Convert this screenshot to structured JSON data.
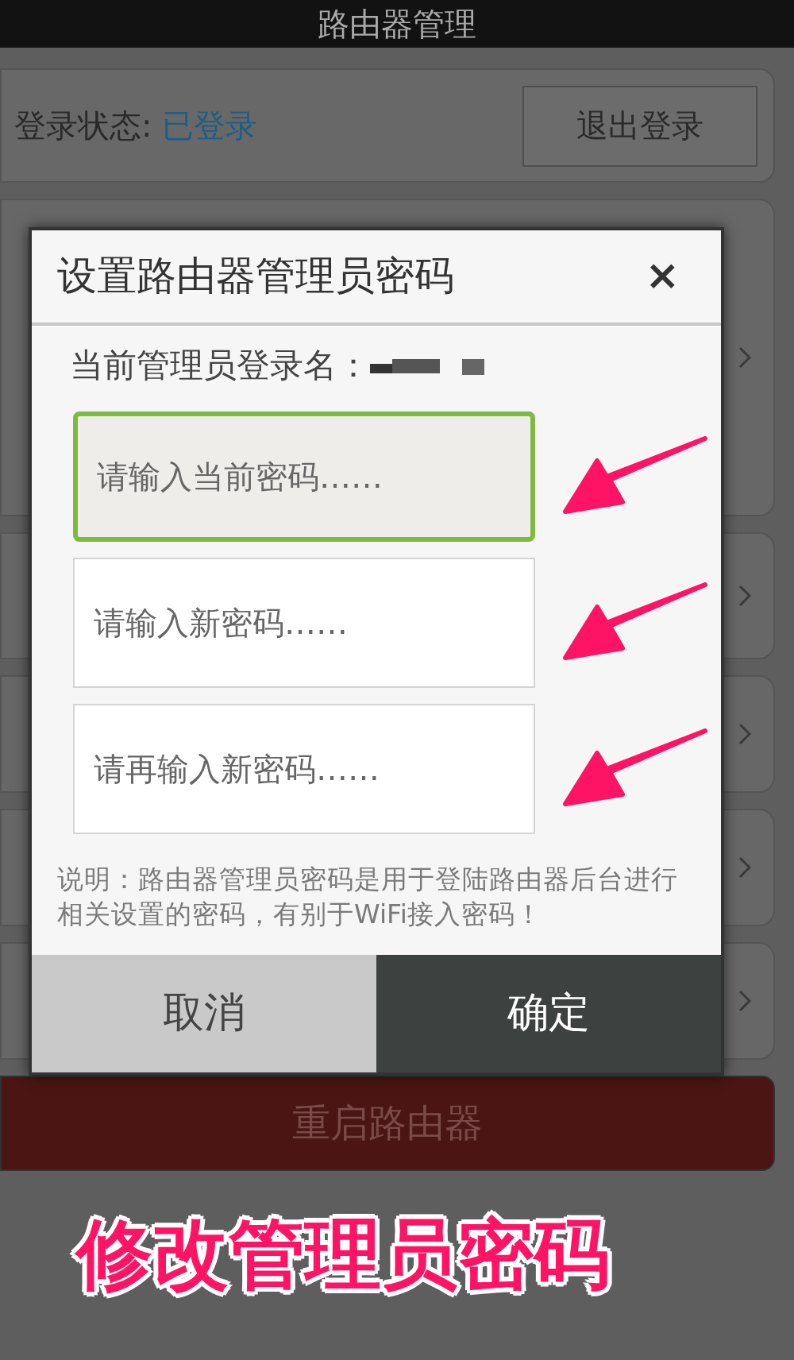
{
  "app_bar": {
    "title": "路由器管理"
  },
  "login_card": {
    "label": "登录状态:",
    "status": "已登录",
    "logout_button": "退出登录"
  },
  "reboot_button": "重启路由器",
  "dialog": {
    "title": "设置路由器管理员密码",
    "close": "×",
    "account_label": "当前管理员登录名：",
    "fields": [
      {
        "placeholder": "请输入当前密码……",
        "focused": true,
        "arrow": true
      },
      {
        "placeholder": "请输入新密码……",
        "focused": false,
        "arrow": true
      },
      {
        "placeholder": "请再输入新密码……",
        "focused": false,
        "arrow": true
      }
    ],
    "note": "说明：路由器管理员密码是用于登陆路由器后台进行相关设置的密码，有别于WiFi接入密码！",
    "buttons": [
      {
        "label": "取消",
        "kind": "cancel"
      },
      {
        "label": "确定",
        "kind": "confirm"
      }
    ]
  },
  "caption": "修改管理员密码"
}
